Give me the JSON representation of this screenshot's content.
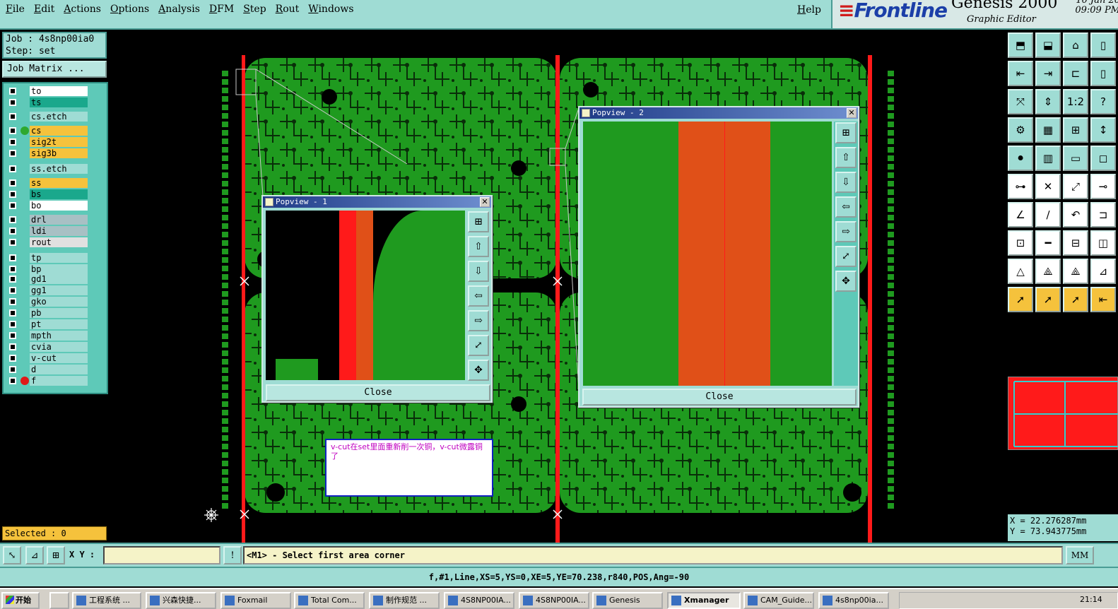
{
  "menubar": {
    "items": [
      "File",
      "Edit",
      "Actions",
      "Options",
      "Analysis",
      "DFM",
      "Step",
      "Rout",
      "Windows"
    ],
    "help": "Help"
  },
  "brand": {
    "logo": "Frontline",
    "app": "Genesis 2000",
    "subtitle": "Graphic Editor",
    "date": "10 Jan 20",
    "time": "09:09 PM"
  },
  "left": {
    "job": "Job : 4s8np00ia0",
    "step": "Step: set",
    "job_matrix": "Job Matrix ...",
    "layers": [
      {
        "name": "to",
        "color": "#ffffff"
      },
      {
        "name": "ts",
        "color": "#1aa88c"
      },
      {
        "name": "cs.etch",
        "color": "#9fdcd4"
      },
      {
        "name": "cs",
        "color": "#f5c23c",
        "dot": "#2ea82e"
      },
      {
        "name": "sig2t",
        "color": "#f5c23c"
      },
      {
        "name": "sig3b",
        "color": "#f5c23c"
      },
      {
        "name": "ss.etch",
        "color": "#9fdcd4"
      },
      {
        "name": "ss",
        "color": "#f5c23c"
      },
      {
        "name": "bs",
        "color": "#1aa88c"
      },
      {
        "name": "bo",
        "color": "#ffffff"
      },
      {
        "name": "drl",
        "color": "#a8c0c4"
      },
      {
        "name": "ldi",
        "color": "#a8c0c4"
      },
      {
        "name": "rout",
        "color": "#e0e0e0"
      },
      {
        "name": "tp",
        "color": "#9fdcd4"
      },
      {
        "name": "bp",
        "color": "#9fdcd4"
      },
      {
        "name": "gd1",
        "color": "#9fdcd4"
      },
      {
        "name": "gg1",
        "color": "#9fdcd4"
      },
      {
        "name": "gko",
        "color": "#9fdcd4"
      },
      {
        "name": "pb",
        "color": "#9fdcd4"
      },
      {
        "name": "pt",
        "color": "#9fdcd4"
      },
      {
        "name": "mpth",
        "color": "#9fdcd4"
      },
      {
        "name": "cvia",
        "color": "#9fdcd4"
      },
      {
        "name": "v-cut",
        "color": "#9fdcd4"
      },
      {
        "name": "d",
        "color": "#9fdcd4"
      },
      {
        "name": "f",
        "color": "#9fdcd4",
        "dot": "#e01818"
      }
    ],
    "selected": "Selected : 0"
  },
  "popview1": {
    "title": "Popview - 1",
    "close": "Close"
  },
  "popview2": {
    "title": "Popview - 2",
    "close": "Close"
  },
  "note": "v-cut在set里面重新削一次铜，v-cut微露铜了",
  "coords": {
    "x": "X = 22.276287mm",
    "y": "Y = 73.943775mm"
  },
  "cmd": {
    "xy_label": "X Y :",
    "xy_value": "",
    "prompt": "<M1> - Select first area corner",
    "units": "MM"
  },
  "info": "f,#1,Line,XS=5,YS=0,XE=5,YE=70.238,r840,POS,Ang=-90",
  "taskbar": {
    "start": "开始",
    "tasks": [
      "工程系统 ...",
      "兴森快捷...",
      "Foxmail",
      "Total Com...",
      "制作规范 ...",
      "4S8NP00IA...",
      "4S8NP00IA...",
      "Genesis",
      "Xmanager",
      "CAM_Guide...",
      "4s8np00ia..."
    ],
    "clock": "21:14"
  },
  "colors": {
    "panel": "#9fdcd4",
    "board": "#1f9a1f",
    "vcut": "#ff1a1a",
    "copper": "#e05018"
  }
}
